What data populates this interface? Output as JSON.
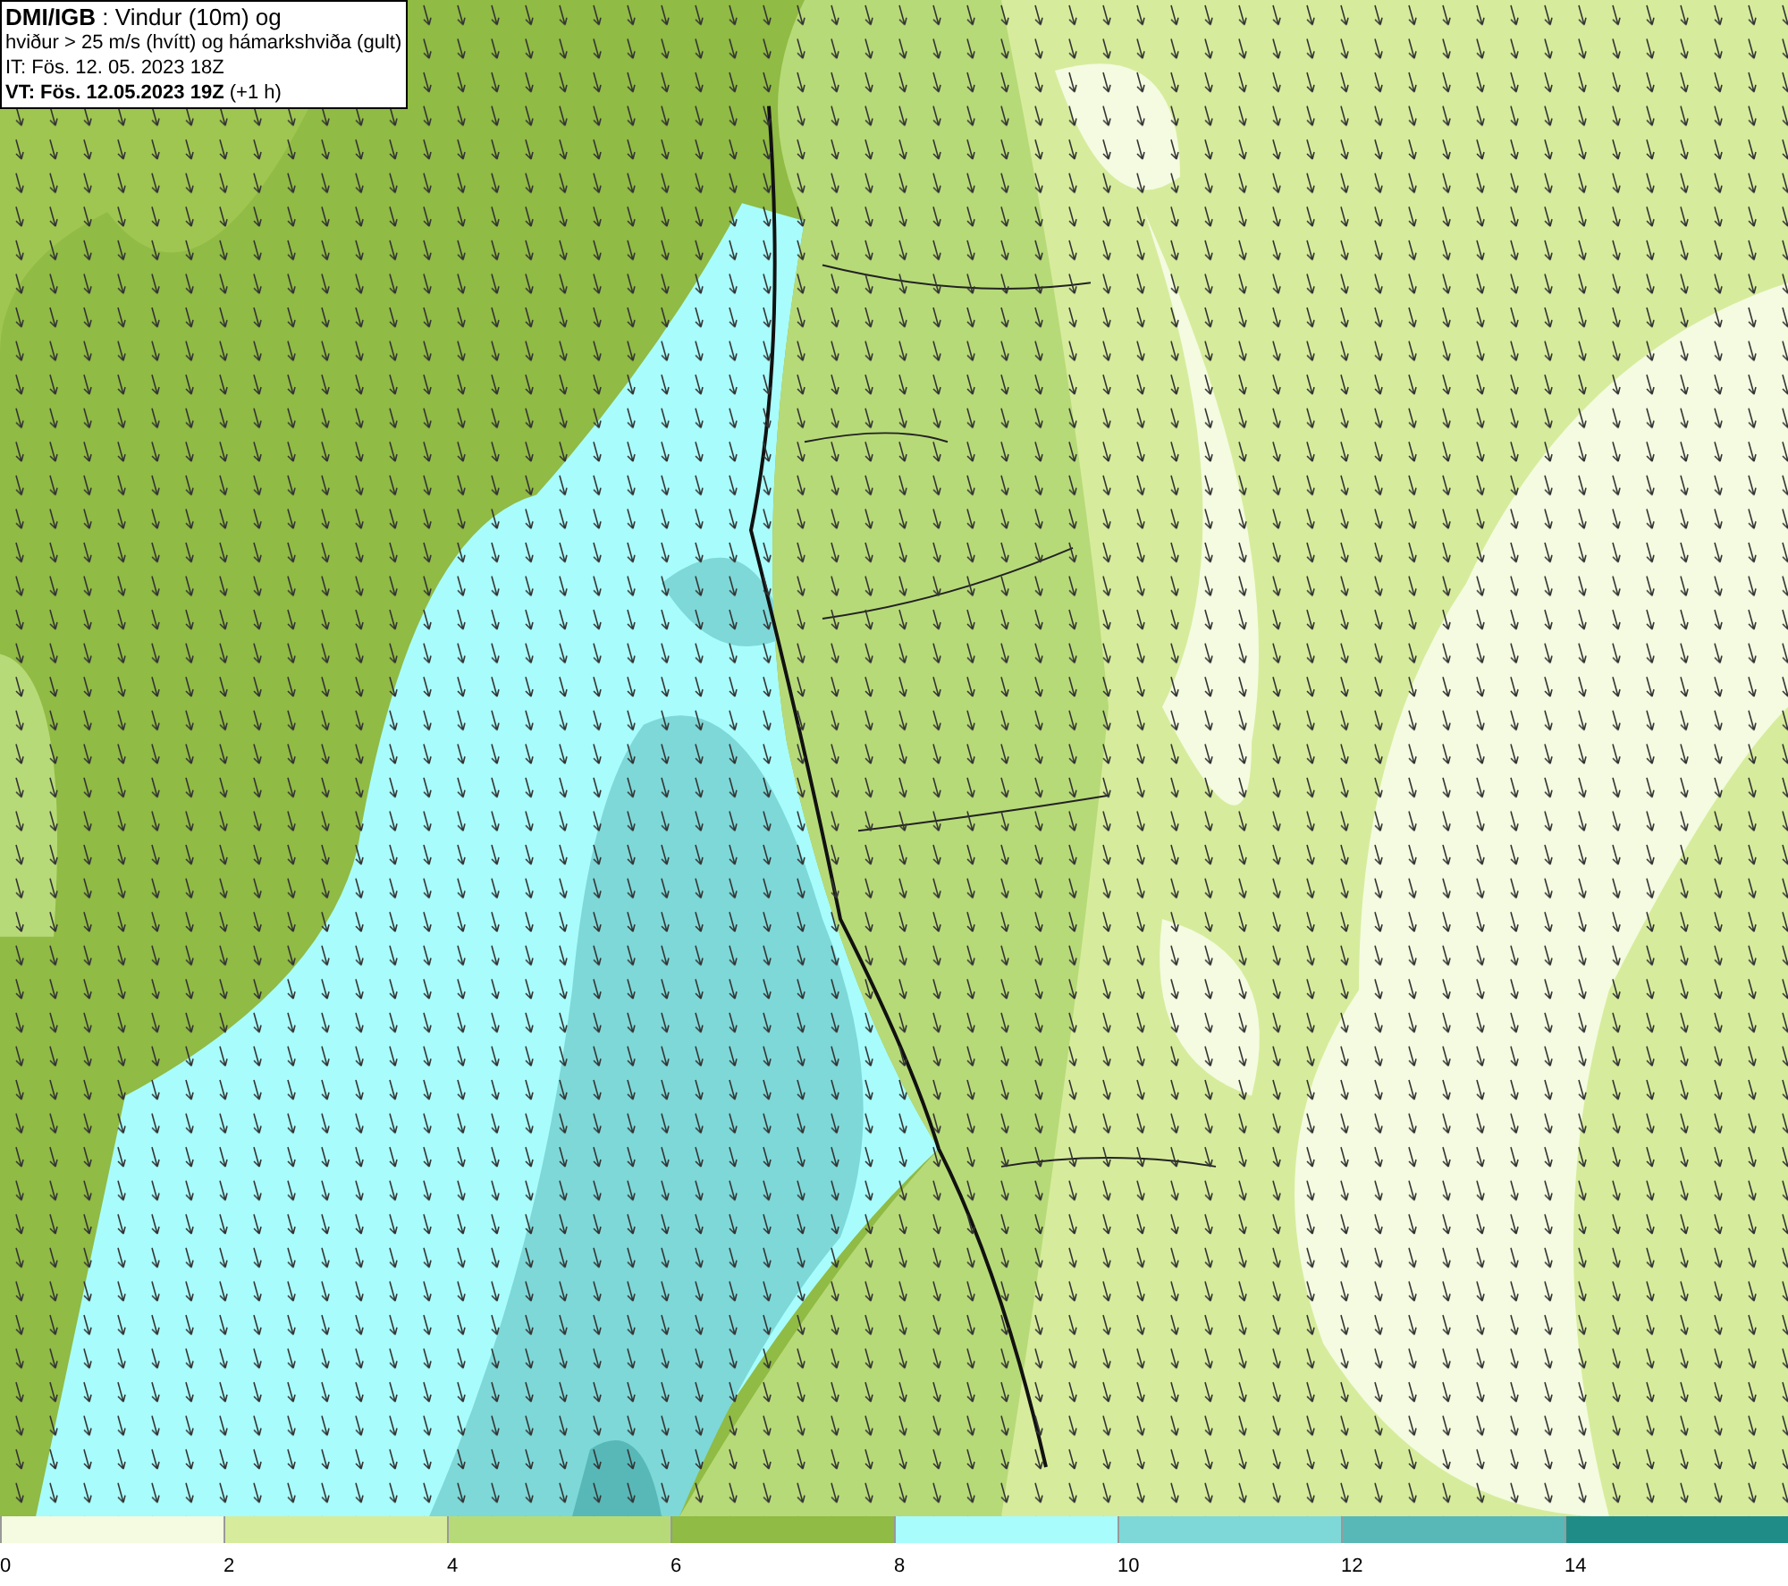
{
  "title_box": {
    "lines": [
      "**DMI/IGB** : Vindur (10m) og",
      "hviður > 25 m/s (hvítt) og hámarkshviða (gult)",
      "IT: Fös. 12. 05. 2023 18Z",
      "**VT: Fös. 12.05.2023 19Z** (+1 h)"
    ]
  },
  "legend": [
    {
      "label": "0",
      "color": "#f4fbe0"
    },
    {
      "label": "2",
      "color": "#d6ec9c"
    },
    {
      "label": "4",
      "color": "#b7da78"
    },
    {
      "label": "6",
      "color": "#90bb44"
    },
    {
      "label": "8",
      "color": "#a8fcfc"
    },
    {
      "label": "10",
      "color": "#7ed8d8"
    },
    {
      "label": "12",
      "color": "#58b8b8"
    },
    {
      "label": "14",
      "color": "#208c88"
    }
  ]
}
